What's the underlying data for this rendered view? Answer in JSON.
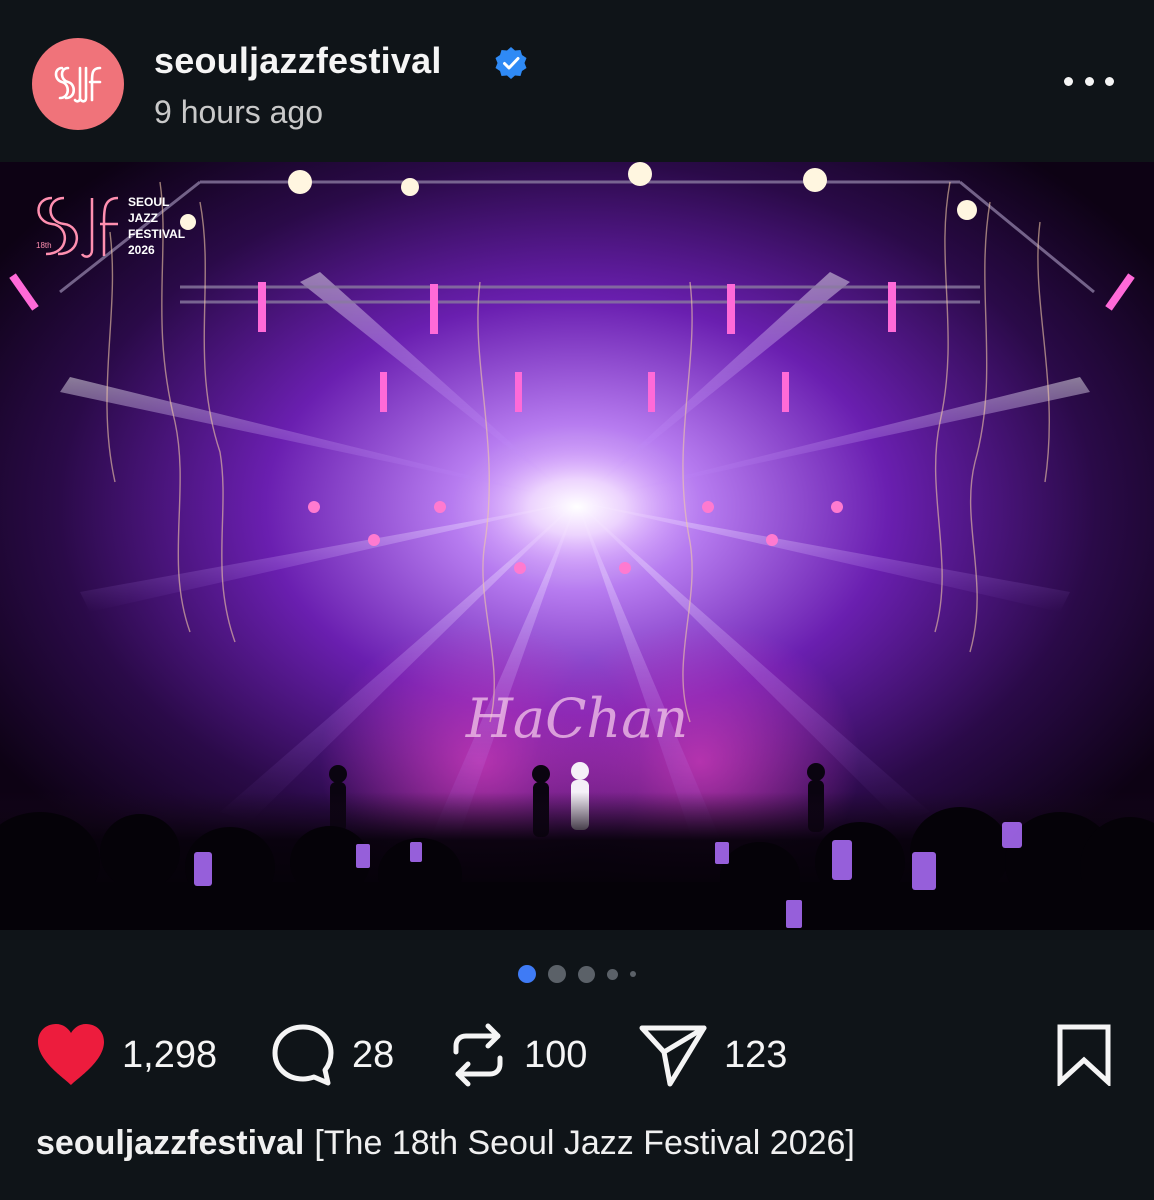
{
  "post": {
    "username": "seouljazzfestival",
    "time_ago": "9 hours ago",
    "verified": true,
    "avatar_color": "#f0737a",
    "avatar_icon": "sjf-logo-icon"
  },
  "image": {
    "logo_lines": [
      "SEOUL",
      "JAZZ",
      "FESTIVAL",
      "2026"
    ],
    "logo_edition": "18th",
    "stage_sign": "HaChan",
    "description_icon": "concert-stage-photo"
  },
  "carousel": {
    "count": 5,
    "active_index": 0
  },
  "actions": {
    "likes": "1,298",
    "comments": "28",
    "reposts": "100",
    "shares": "123",
    "like_color": "#ed1c3d"
  },
  "caption": {
    "username": "seouljazzfestival",
    "text": "[The 18th Seoul Jazz Festival 2026]"
  },
  "colors": {
    "background": "#0f1418",
    "verified_blue": "#2f8af5",
    "dot_active": "#3f7bf5"
  }
}
